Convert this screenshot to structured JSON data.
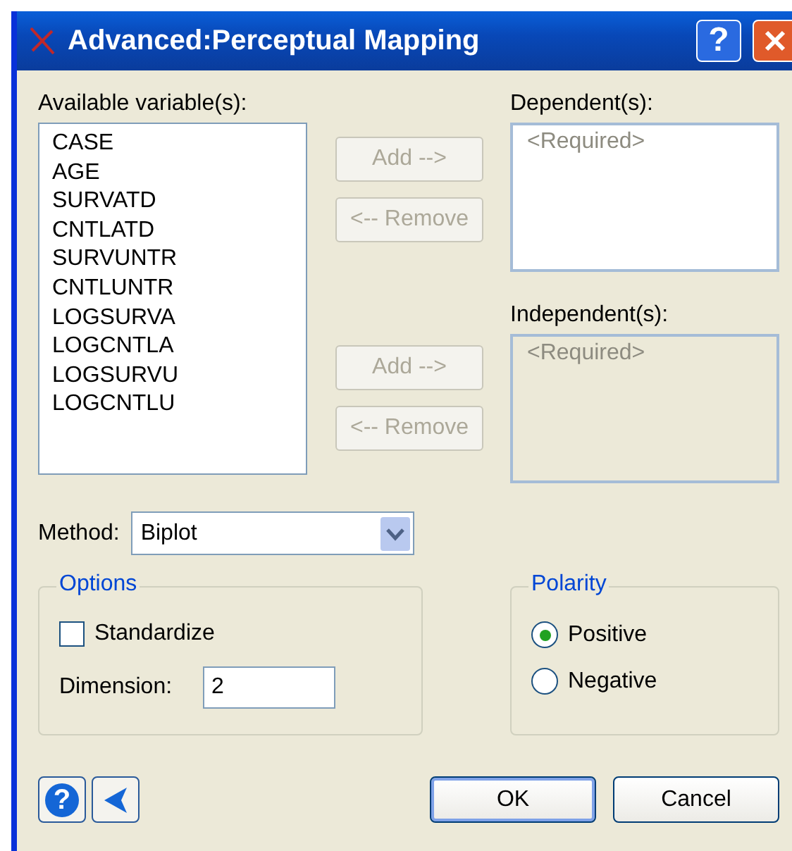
{
  "window": {
    "title": "Advanced:Perceptual Mapping",
    "help_glyph": "?"
  },
  "available": {
    "label": "Available variable(s):",
    "items": [
      "CASE",
      "AGE",
      "SURVATD",
      "CNTLATD",
      "SURVUNTR",
      "CNTLUNTR",
      "LOGSURVA",
      "LOGCNTLA",
      "LOGSURVU",
      "LOGCNTLU"
    ]
  },
  "targets": [
    {
      "label": "Dependent(s):",
      "placeholder": "<Required>",
      "disabled": false,
      "buttons": [
        {
          "label": "Add -->",
          "disabled": true
        },
        {
          "label": "<-- Remove",
          "disabled": true
        }
      ]
    },
    {
      "label": "Independent(s):",
      "placeholder": "<Required>",
      "disabled": true,
      "buttons": [
        {
          "label": "Add -->",
          "disabled": true
        },
        {
          "label": "<-- Remove",
          "disabled": true
        }
      ]
    }
  ],
  "method": {
    "label": "Method:",
    "value": "Biplot"
  },
  "options": {
    "title": "Options",
    "standardize": {
      "label": "Standardize",
      "checked": false
    },
    "dimension": {
      "label": "Dimension:",
      "value": "2"
    }
  },
  "polarity": {
    "title": "Polarity",
    "choices": [
      {
        "label": "Positive",
        "selected": true
      },
      {
        "label": "Negative",
        "selected": false
      }
    ]
  },
  "help_glyph": "?",
  "buttons": [
    {
      "label": "OK",
      "default": true
    },
    {
      "label": "Cancel",
      "default": false
    }
  ]
}
